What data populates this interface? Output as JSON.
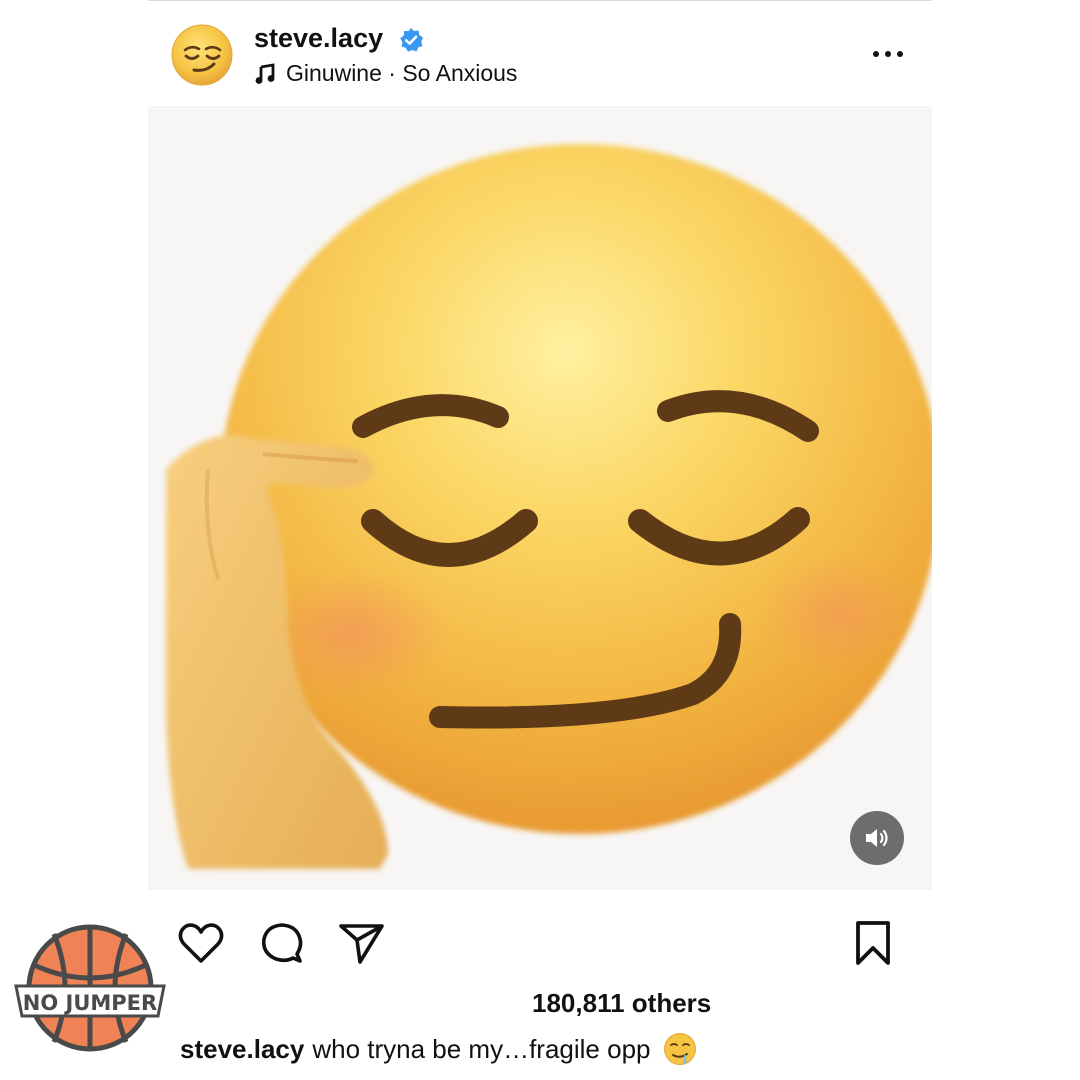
{
  "header": {
    "username": "steve.lacy",
    "verified": true,
    "music_artist": "Ginuwine",
    "music_separator": " · ",
    "music_song": "So Anxious",
    "avatar_icon": "relieved-face-emoji-icon",
    "more_icon": "more-options-icon"
  },
  "media": {
    "image_icon": "face-with-hand-on-temple-emoji-icon",
    "sound_icon": "speaker-icon"
  },
  "actions": {
    "like_icon": "heart-icon",
    "comment_icon": "comment-bubble-icon",
    "share_icon": "paper-plane-icon",
    "save_icon": "bookmark-icon"
  },
  "likes": {
    "text": "180,811 others"
  },
  "caption": {
    "username": "steve.lacy",
    "text": "who tryna be my…fragile opp",
    "emoji_icon": "drooling-face-emoji-icon"
  },
  "watermark": {
    "text": "NO JUMPER",
    "icon": "basketball-logo-icon"
  },
  "colors": {
    "verified_blue": "#3897f0",
    "emoji_yellow": "#f5c542",
    "watermark_orange": "#ef8355"
  }
}
